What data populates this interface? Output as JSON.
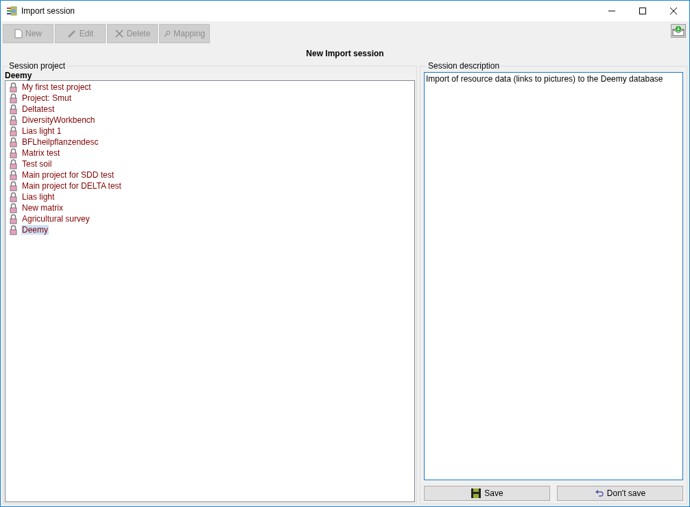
{
  "window": {
    "title": "Import session"
  },
  "toolbar": [
    {
      "label": "New",
      "kind": "new",
      "disabled": true
    },
    {
      "label": "Edit",
      "kind": "edit",
      "disabled": true
    },
    {
      "label": "Delete",
      "kind": "delete",
      "disabled": true
    },
    {
      "label": "Mapping",
      "kind": "mapping",
      "disabled": true
    }
  ],
  "heading": "New Import session",
  "session_project": {
    "legend": "Session project",
    "current": "Deemy",
    "projects": [
      {
        "label": "My first test project",
        "selected": false
      },
      {
        "label": "Project: Smut",
        "selected": false
      },
      {
        "label": "Deltatest",
        "selected": false
      },
      {
        "label": "DiversityWorkbench",
        "selected": false
      },
      {
        "label": "Lias light 1",
        "selected": false
      },
      {
        "label": "BFLheilpflanzendesc",
        "selected": false
      },
      {
        "label": "Matrix test",
        "selected": false
      },
      {
        "label": "Test soil",
        "selected": false
      },
      {
        "label": "Main project for SDD test",
        "selected": false
      },
      {
        "label": "Main project for DELTA test",
        "selected": false
      },
      {
        "label": "Lias light",
        "selected": false
      },
      {
        "label": "New matrix",
        "selected": false
      },
      {
        "label": "Agricultural survey",
        "selected": false
      },
      {
        "label": "Deemy",
        "selected": true
      }
    ]
  },
  "session_description": {
    "legend": "Session description",
    "value": "Import of resource data (links to pictures) to the Deemy database"
  },
  "buttons": [
    {
      "label": "Save",
      "kind": "save"
    },
    {
      "label": "Don't save",
      "kind": "undo"
    }
  ]
}
